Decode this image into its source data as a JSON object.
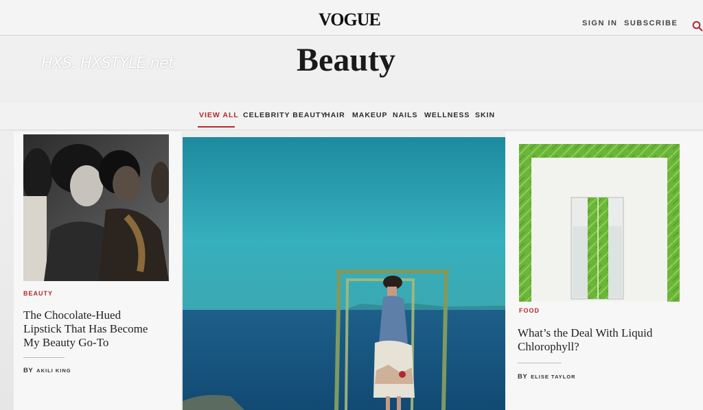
{
  "header": {
    "logo": "VOGUE",
    "sign_in": "SIGN IN",
    "subscribe": "SUBSCRIBE"
  },
  "watermark": "HXS. HXSTYLE.net",
  "page_title": "Beauty",
  "nav": {
    "items": [
      {
        "label": "VIEW ALL",
        "active": true
      },
      {
        "label": "CELEBRITY BEAUTY"
      },
      {
        "label": "HAIR"
      },
      {
        "label": "MAKEUP"
      },
      {
        "label": "NAILS"
      },
      {
        "label": "WELLNESS"
      },
      {
        "label": "SKIN"
      }
    ]
  },
  "articles": [
    {
      "kicker": "BEAUTY",
      "headline_lines": [
        "The Chocolate-Hued",
        "Lipstick That Has Become",
        "My Beauty Go-To"
      ],
      "by": "BY",
      "author": "AKILI KING"
    },
    {
      "kicker": "FOOD",
      "headline_lines": [
        "What’s the Deal With Liquid",
        "Chlorophyll?"
      ],
      "by": "BY",
      "author": "ELISE TAYLOR"
    }
  ],
  "colors": {
    "accent": "#b3272d",
    "sea": "#1f6f88",
    "sky": "#2aa2b4",
    "leaf": "#5ea832"
  }
}
